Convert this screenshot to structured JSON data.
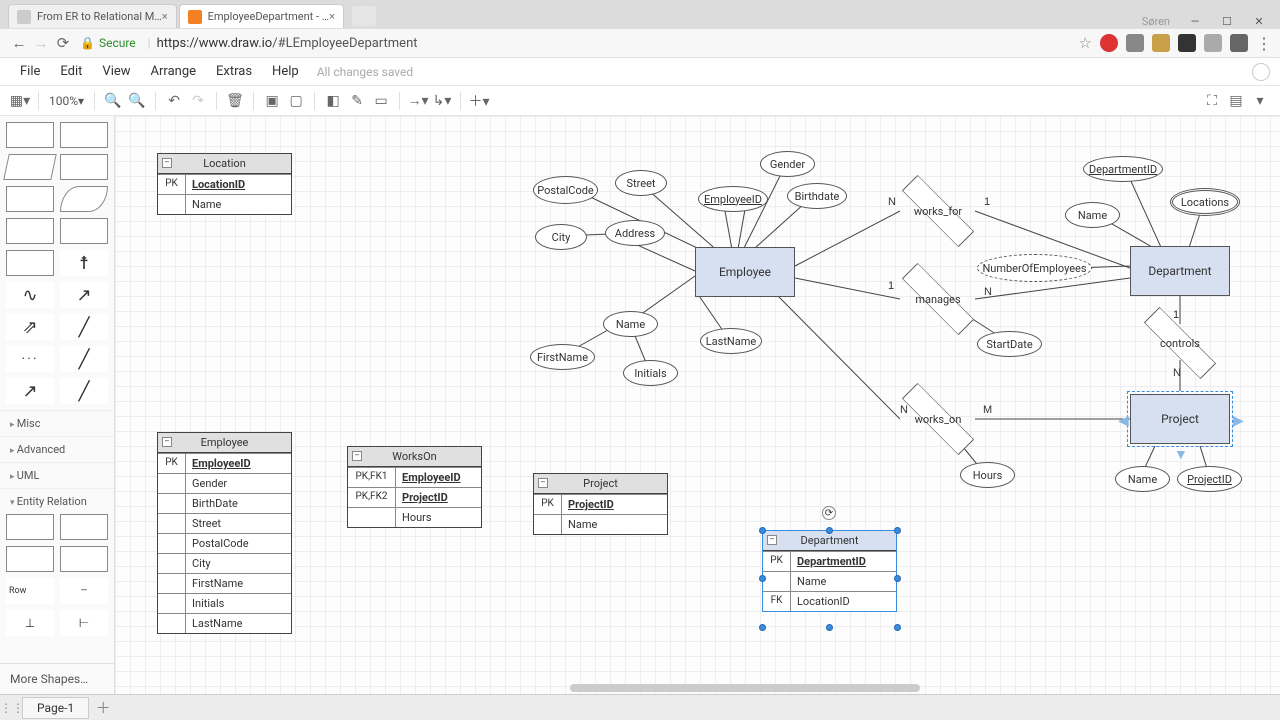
{
  "browser": {
    "tabs": [
      {
        "title": "From ER to Relational M…",
        "active": false
      },
      {
        "title": "EmployeeDepartment - …",
        "active": true
      }
    ],
    "user": "Søren",
    "nav": {
      "back": "←",
      "forward": "→",
      "reload": "⟳"
    },
    "secure_label": "Secure",
    "url_host": "https://www.draw.io",
    "url_path": "/#LEmployeeDepartment",
    "star": "☆"
  },
  "menubar": {
    "items": [
      "File",
      "Edit",
      "View",
      "Arrange",
      "Extras",
      "Help"
    ],
    "status": "All changes saved"
  },
  "toolbar": {
    "zoom": "100%"
  },
  "sidebar": {
    "sections": [
      "Misc",
      "Advanced",
      "UML",
      "Entity Relation"
    ],
    "row_label": "Row",
    "more": "More Shapes…"
  },
  "er": {
    "entities": {
      "employee": "Employee",
      "department": "Department",
      "project": "Project"
    },
    "attrs": {
      "postalcode": "PostalCode",
      "street": "Street",
      "city": "City",
      "address": "Address",
      "employeeid": "EmployeeID",
      "gender": "Gender",
      "birthdate": "Birthdate",
      "name_emp": "Name",
      "firstname": "FirstName",
      "lastname": "LastName",
      "initials": "Initials",
      "departmentid": "DepartmentID",
      "locations": "Locations",
      "name_dept": "Name",
      "numemp": "NumberOfEmployees",
      "startdate": "StartDate",
      "hours": "Hours",
      "name_proj": "Name",
      "projectid": "ProjectID"
    },
    "rels": {
      "works_for": "works_for",
      "manages": "manages",
      "controls": "controls",
      "works_on": "works_on"
    },
    "cards": {
      "n": "N",
      "m": "M",
      "one": "1"
    }
  },
  "tables": {
    "location": {
      "name": "Location",
      "rows": [
        {
          "key": "PK",
          "val": "LocationID",
          "pk": true
        },
        {
          "key": "",
          "val": "Name"
        }
      ]
    },
    "employee": {
      "name": "Employee",
      "rows": [
        {
          "key": "PK",
          "val": "EmployeeID",
          "pk": true
        },
        {
          "key": "",
          "val": "Gender"
        },
        {
          "key": "",
          "val": "BirthDate"
        },
        {
          "key": "",
          "val": "Street"
        },
        {
          "key": "",
          "val": "PostalCode"
        },
        {
          "key": "",
          "val": "City"
        },
        {
          "key": "",
          "val": "FirstName"
        },
        {
          "key": "",
          "val": "Initials"
        },
        {
          "key": "",
          "val": "LastName"
        }
      ]
    },
    "workson": {
      "name": "WorksOn",
      "rows": [
        {
          "key": "PK,FK1",
          "val": "EmployeeID",
          "pk": true
        },
        {
          "key": "PK,FK2",
          "val": "ProjectID",
          "pk": true
        },
        {
          "key": "",
          "val": "Hours"
        }
      ]
    },
    "project": {
      "name": "Project",
      "rows": [
        {
          "key": "PK",
          "val": "ProjectID",
          "pk": true
        },
        {
          "key": "",
          "val": "Name"
        }
      ]
    },
    "department": {
      "name": "Department",
      "rows": [
        {
          "key": "PK",
          "val": "DepartmentID",
          "pk": true
        },
        {
          "key": "",
          "val": "Name"
        },
        {
          "key": "FK",
          "val": "LocationID"
        }
      ]
    }
  },
  "footer": {
    "page": "Page-1"
  }
}
